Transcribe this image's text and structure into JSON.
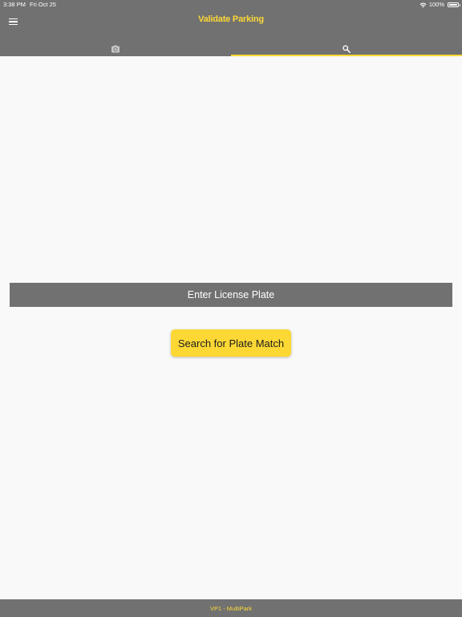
{
  "status_bar": {
    "time": "3:38 PM",
    "date": "Fri Oct 25",
    "battery": "100%",
    "wifi_icon": "wifi-icon",
    "battery_icon": "battery-icon"
  },
  "header": {
    "title": "Validate Parking",
    "menu_icon": "menu-icon"
  },
  "tabs": [
    {
      "icon": "camera-icon",
      "selected": false
    },
    {
      "icon": "search-icon",
      "selected": true
    }
  ],
  "main": {
    "plate_input": {
      "placeholder": "Enter License Plate",
      "value": ""
    },
    "search_button_label": "Search for Plate Match"
  },
  "footer": {
    "text": "VP1 - MultiPark"
  },
  "colors": {
    "bar": "#717171",
    "accent": "#fdd835",
    "background": "#f9f9f9"
  }
}
